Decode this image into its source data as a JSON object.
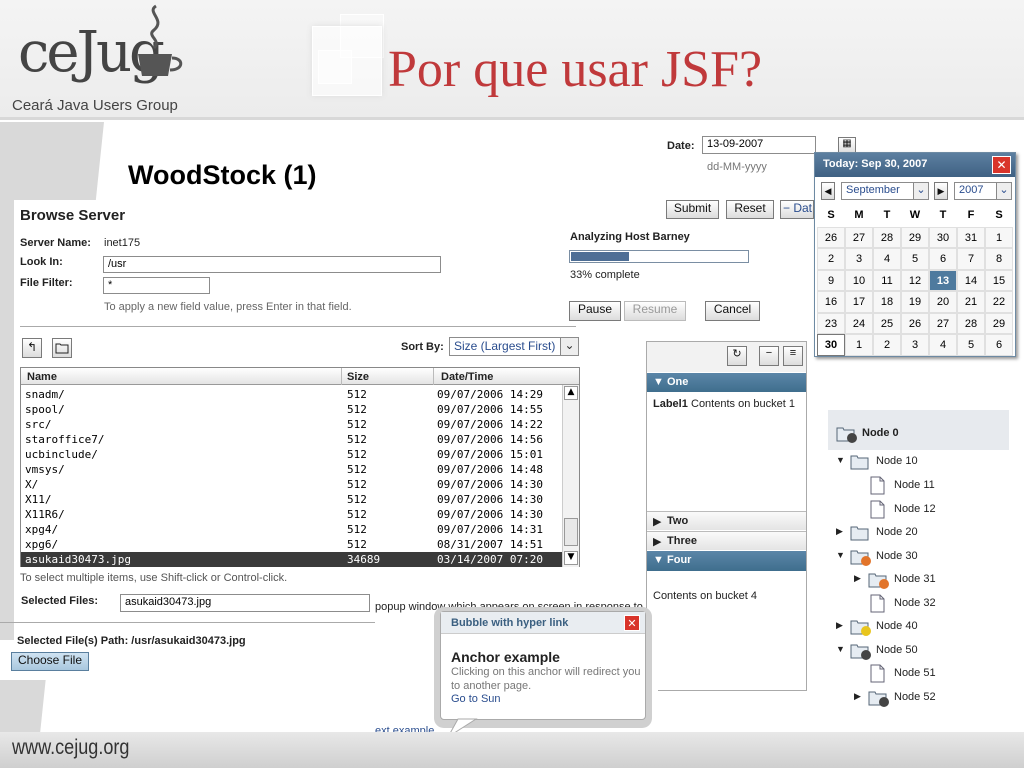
{
  "header": {
    "logo_text": "ceJug",
    "logo_subtitle": "Ceará Java Users Group",
    "slide_title": "Por que usar JSF?",
    "subtitle": "WoodStock (1)"
  },
  "footer": {
    "url": "www.cejug.org"
  },
  "browse_server": {
    "title": "Browse Server",
    "server_name_label": "Server Name:",
    "server_name_value": "inet175",
    "look_in_label": "Look In:",
    "look_in_value": "/usr",
    "file_filter_label": "File Filter:",
    "file_filter_value": "*",
    "hint": "To apply a new field value, press Enter in that field.",
    "sort_by_label": "Sort By:",
    "sort_by_value": "Size (Largest First)",
    "columns": [
      "Name",
      "Size",
      "Date/Time"
    ],
    "rows": [
      {
        "name": "snadm/",
        "size": "512",
        "date": "09/07/2006 14:29"
      },
      {
        "name": "spool/",
        "size": "512",
        "date": "09/07/2006 14:55"
      },
      {
        "name": "src/",
        "size": "512",
        "date": "09/07/2006 14:22"
      },
      {
        "name": "staroffice7/",
        "size": "512",
        "date": "09/07/2006 14:56"
      },
      {
        "name": "ucbinclude/",
        "size": "512",
        "date": "09/07/2006 15:01"
      },
      {
        "name": "vmsys/",
        "size": "512",
        "date": "09/07/2006 14:48"
      },
      {
        "name": "X/",
        "size": "512",
        "date": "09/07/2006 14:30"
      },
      {
        "name": "X11/",
        "size": "512",
        "date": "09/07/2006 14:30"
      },
      {
        "name": "X11R6/",
        "size": "512",
        "date": "09/07/2006 14:30"
      },
      {
        "name": "xpg4/",
        "size": "512",
        "date": "09/07/2006 14:31"
      },
      {
        "name": "xpg6/",
        "size": "512",
        "date": "08/31/2007 14:51"
      },
      {
        "name": "asukaid30473.jpg",
        "size": "34689",
        "date": "03/14/2007 07:20"
      }
    ],
    "multi_select_hint": "To select multiple items, use Shift-click or Control-click.",
    "selected_files_label": "Selected Files:",
    "selected_files_value": "asukaid30473.jpg",
    "selected_path": "Selected File(s) Path: /usr/asukaid30473.jpg",
    "choose_file_label": "Choose File"
  },
  "date_form": {
    "date_label": "Date:",
    "date_value": "13-09-2007",
    "date_format": "dd-MM-yyyy",
    "submit_label": "Submit",
    "reset_label": "Reset",
    "partial_label": "− Dat"
  },
  "calendar": {
    "today_label": "Today: Sep 30, 2007",
    "month": "September",
    "year": "2007",
    "weekdays": [
      "S",
      "M",
      "T",
      "W",
      "T",
      "F",
      "S"
    ],
    "weeks": [
      [
        "26",
        "27",
        "28",
        "29",
        "30",
        "31",
        "1"
      ],
      [
        "2",
        "3",
        "4",
        "5",
        "6",
        "7",
        "8"
      ],
      [
        "9",
        "10",
        "11",
        "12",
        "13",
        "14",
        "15"
      ],
      [
        "16",
        "17",
        "18",
        "19",
        "20",
        "21",
        "22"
      ],
      [
        "23",
        "24",
        "25",
        "26",
        "27",
        "28",
        "29"
      ],
      [
        "30",
        "1",
        "2",
        "3",
        "4",
        "5",
        "6"
      ]
    ],
    "selected_day": "13",
    "today_day": "30"
  },
  "progress": {
    "title": "Analyzing Host Barney",
    "percent_text": "33% complete",
    "fraction": 0.33,
    "pause_label": "Pause",
    "resume_label": "Resume",
    "cancel_label": "Cancel"
  },
  "accordion": {
    "sections": [
      {
        "title": "One",
        "expanded": true,
        "label": "Label1",
        "content": "Contents on bucket 1"
      },
      {
        "title": "Two",
        "expanded": false
      },
      {
        "title": "Three",
        "expanded": false
      },
      {
        "title": "Four",
        "expanded": true,
        "content": "Contents on bucket 4"
      }
    ]
  },
  "popup_fragment": "popup window which appears on screen in response to a",
  "bubble": {
    "title": "Bubble with hyper link",
    "heading": "Anchor example",
    "body": "Clicking on this anchor will redirect you to another page.",
    "link": "Go to Sun"
  },
  "next_example": "ext example",
  "tree": {
    "nodes": [
      {
        "label": "Node 0"
      },
      {
        "label": "Node 10"
      },
      {
        "label": "Node 11"
      },
      {
        "label": "Node 12"
      },
      {
        "label": "Node 20"
      },
      {
        "label": "Node 30"
      },
      {
        "label": "Node 31"
      },
      {
        "label": "Node 32"
      },
      {
        "label": "Node 40"
      },
      {
        "label": "Node 50"
      },
      {
        "label": "Node 51"
      },
      {
        "label": "Node 52"
      }
    ]
  },
  "colors": {
    "title_red": "#c0393b",
    "accordion_header": "#3f6e8d",
    "calendar_header": "#4a6d8c",
    "selected_row": "#3a3a3a"
  }
}
